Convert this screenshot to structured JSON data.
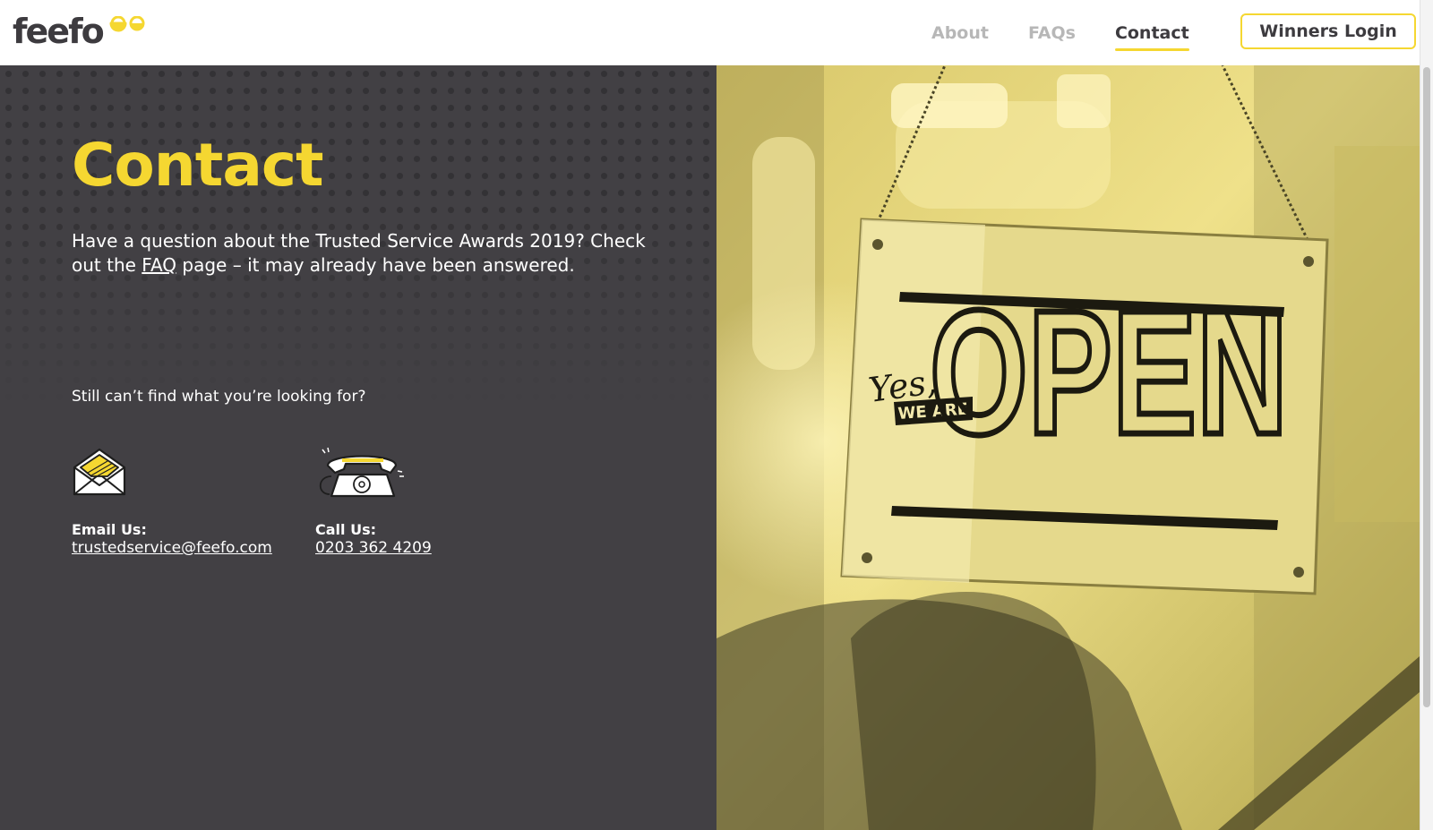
{
  "brand": {
    "logo_text": "feefo",
    "accent": "#f5d731",
    "dark": "#424044"
  },
  "nav": {
    "items": [
      {
        "label": "About",
        "active": false
      },
      {
        "label": "FAQs",
        "active": false
      },
      {
        "label": "Contact",
        "active": true
      }
    ],
    "login_label": "Winners Login"
  },
  "main": {
    "title": "Contact",
    "intro_before": "Have a question about the Trusted Service Awards 2019? Check out the ",
    "faq_link": "FAQ",
    "intro_after": " page – it may already have been answered.",
    "still_text": "Still can’t find what you’re looking for?",
    "email": {
      "label": "Email Us:",
      "value": "trustedservice@feefo.com",
      "icon": "envelope-icon"
    },
    "phone": {
      "label": "Call Us:",
      "value": "0203 362 4209",
      "icon": "telephone-icon"
    }
  },
  "photo": {
    "description_icon": "open-sign-photo",
    "sign_script": "Yes,",
    "sign_banner": "WE ARE",
    "sign_word": "OPEN"
  }
}
